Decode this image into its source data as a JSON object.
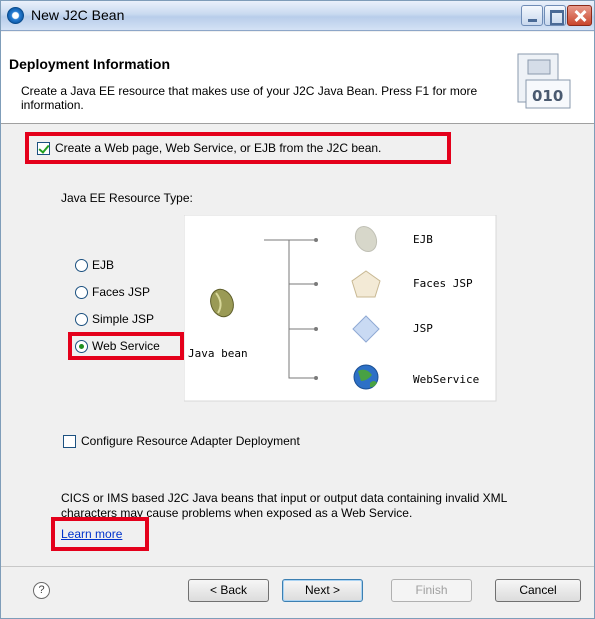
{
  "window": {
    "title": "New J2C Bean"
  },
  "header": {
    "title": "Deployment Information",
    "description": "Create a Java EE resource that makes use of your J2C Java Bean. Press F1 for more information."
  },
  "create_checkbox": {
    "label": "Create a Web page, Web Service, or EJB from the J2C bean.",
    "checked": true
  },
  "resource_type": {
    "label": "Java EE Resource Type:",
    "options": [
      "EJB",
      "Faces JSP",
      "Simple JSP",
      "Web Service"
    ],
    "selected": "Web Service"
  },
  "diagram": {
    "source": "Java bean",
    "targets": [
      "EJB",
      "Faces JSP",
      "JSP",
      "WebService"
    ]
  },
  "adapter_checkbox": {
    "label": "Configure Resource Adapter Deployment",
    "checked": false
  },
  "warning": {
    "line1": "CICS or IMS based J2C Java beans that input or output data containing invalid XML",
    "line2": "characters may cause problems when exposed as a Web Service.",
    "link": "Learn more"
  },
  "buttons": {
    "back": "< Back",
    "next": "Next >",
    "finish": "Finish",
    "cancel": "Cancel"
  },
  "highlight_color": "#e4001b"
}
